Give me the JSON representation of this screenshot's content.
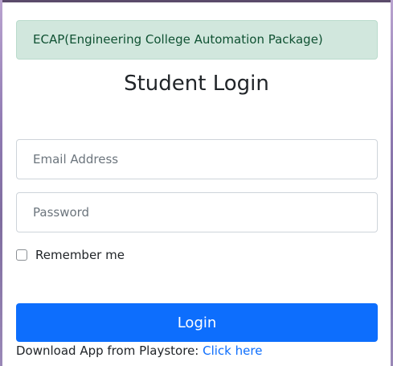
{
  "alert": {
    "text": "ECAP(Engineering College Automation Package)"
  },
  "form": {
    "title": "Student Login",
    "email_placeholder": "Email Address",
    "password_placeholder": "Password",
    "remember_label": "Remember me",
    "login_label": "Login"
  },
  "footer": {
    "download_text": "Download App from Playstore: ",
    "download_link": "Click here"
  },
  "colors": {
    "primary": "#0d6efd",
    "alert_bg": "#d1e7dd",
    "alert_text": "#0f5132"
  }
}
